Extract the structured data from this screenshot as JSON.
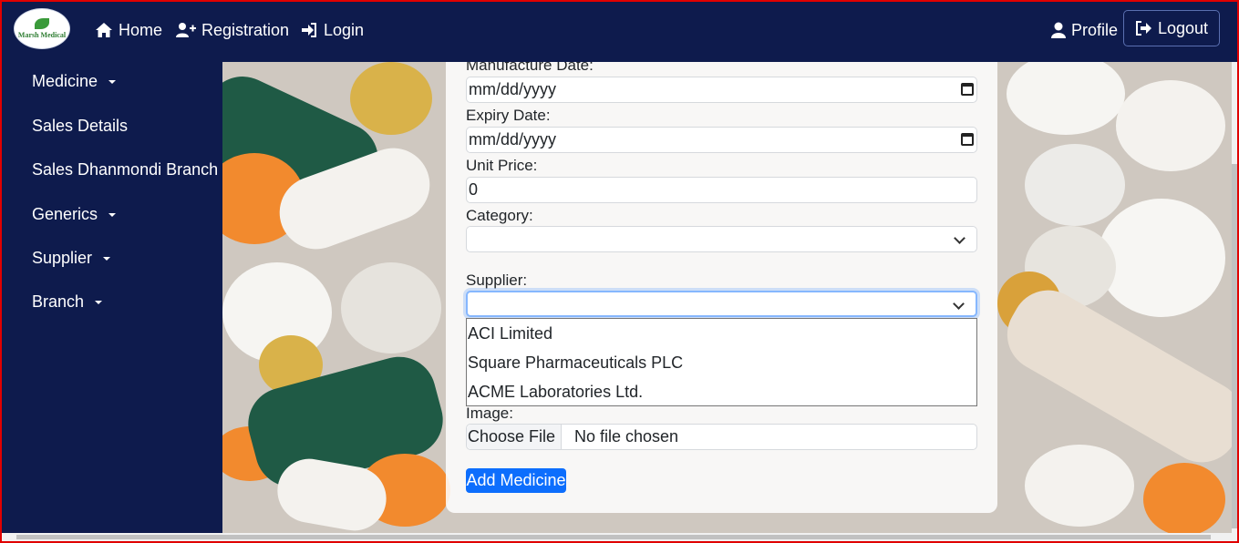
{
  "brand": {
    "logo_text": "Marsh Medical"
  },
  "nav": {
    "home": "Home",
    "registration": "Registration",
    "login": "Login",
    "profile": "Profile",
    "logout": "Logout"
  },
  "sidebar": {
    "items": [
      {
        "label": "Medicine",
        "dropdown": true
      },
      {
        "label": "Sales Details",
        "dropdown": false
      },
      {
        "label": "Sales Dhanmondi Branch",
        "dropdown": false
      },
      {
        "label": "Generics",
        "dropdown": true
      },
      {
        "label": "Supplier",
        "dropdown": true
      },
      {
        "label": "Branch",
        "dropdown": true
      }
    ]
  },
  "form": {
    "manufacture_date": {
      "label": "Manufacture Date:",
      "value": "mm/dd/yyyy"
    },
    "expiry_date": {
      "label": "Expiry Date:",
      "value": "mm/dd/yyyy"
    },
    "unit_price": {
      "label": "Unit Price:",
      "value": "0"
    },
    "category": {
      "label": "Category:",
      "value": ""
    },
    "supplier": {
      "label": "Supplier:",
      "value": "",
      "options": [
        "ACI Limited",
        "Square Pharmaceuticals PLC",
        "ACME Laboratories Ltd."
      ]
    },
    "image": {
      "label": "Image:",
      "button": "Choose File",
      "status": "No file chosen"
    },
    "submit": "Add Medicine"
  },
  "colors": {
    "navbar": "#0e1b4d",
    "sidebar": "#0e1b4d",
    "primary_button": "#0d6efd",
    "frame_border": "#e00000"
  }
}
